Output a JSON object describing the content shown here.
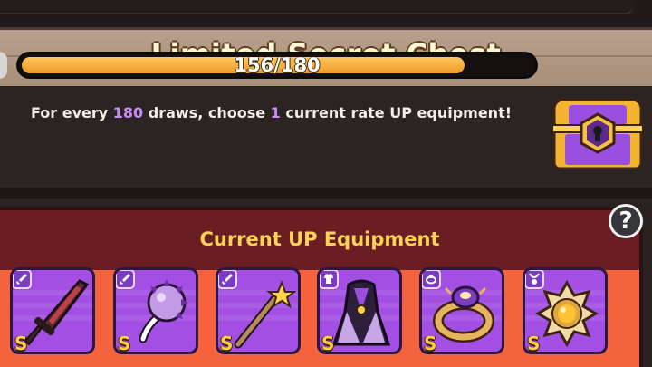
{
  "header": {
    "title": "Limited Secret Chest"
  },
  "info": {
    "desc_prefix": "For every ",
    "draws_required": "180",
    "desc_mid": " draws, choose ",
    "choose_count": "1",
    "desc_suffix": " current rate UP equipment!"
  },
  "progress": {
    "current": 156,
    "total": 180,
    "label": "156/180"
  },
  "up_section": {
    "title": "Current UP Equipment",
    "help_label": "?",
    "items": [
      {
        "slot_icon": "weapon-icon",
        "art": "sword",
        "rank": "S"
      },
      {
        "slot_icon": "weapon-icon",
        "art": "spiked-mace",
        "rank": "S"
      },
      {
        "slot_icon": "weapon-icon",
        "art": "star-wand",
        "rank": "S"
      },
      {
        "slot_icon": "armor-icon",
        "art": "cloak",
        "rank": "S"
      },
      {
        "slot_icon": "ring-icon",
        "art": "ring",
        "rank": "S"
      },
      {
        "slot_icon": "necklace-icon",
        "art": "amulet",
        "rank": "S"
      }
    ]
  },
  "colors": {
    "accent_purple": "#c58cf2",
    "progress_orange": "#f09a2b",
    "panel_red": "#f5623e",
    "card_purple": "#a34fe3",
    "rank_gold": "#ffd040"
  }
}
